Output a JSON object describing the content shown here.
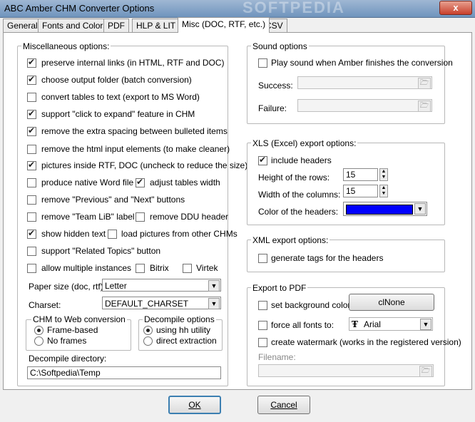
{
  "window": {
    "title": "ABC Amber CHM Converter Options",
    "watermark": "SOFTPEDIA",
    "close_glyph": "x"
  },
  "tabs": [
    {
      "label": "General"
    },
    {
      "label": "Fonts and Colors"
    },
    {
      "label": "PDF"
    },
    {
      "label": "HLP & LIT"
    },
    {
      "label": "Misc (DOC, RTF, etc.)",
      "active": true
    },
    {
      "label": "CSV"
    }
  ],
  "misc": {
    "title": "Miscellaneous options:",
    "options": [
      {
        "label": "preserve internal links (in HTML, RTF and DOC)",
        "checked": true
      },
      {
        "label": "choose output folder (batch conversion)",
        "checked": true
      },
      {
        "label": "convert tables to text (export to MS Word)",
        "checked": false
      },
      {
        "label": "support \"click to expand\" feature in CHM",
        "checked": true
      },
      {
        "label": "remove the extra spacing between bulleted items",
        "checked": true
      },
      {
        "label": "remove the html input elements (to make cleaner)",
        "checked": false
      },
      {
        "label": "pictures inside RTF, DOC (uncheck to reduce the size)",
        "checked": true
      },
      {
        "label": "produce native Word file",
        "checked": false
      },
      {
        "label": "adjust tables width",
        "checked": true
      },
      {
        "label": "remove \"Previous\" and \"Next\" buttons",
        "checked": false
      },
      {
        "label": "remove \"Team LiB\" label",
        "checked": false
      },
      {
        "label": "remove DDU header",
        "checked": false
      },
      {
        "label": "show hidden text",
        "checked": true
      },
      {
        "label": "load pictures from other CHMs",
        "checked": false
      },
      {
        "label": "support \"Related Topics\" button",
        "checked": false
      },
      {
        "label": "allow multiple instances",
        "checked": false
      },
      {
        "label": "Bitrix",
        "checked": false
      },
      {
        "label": "Virtek",
        "checked": false
      }
    ],
    "paper_size_label": "Paper size (doc, rtf):",
    "paper_size_value": "Letter",
    "charset_label": "Charset:",
    "charset_value": "DEFAULT_CHARSET",
    "chm_web": {
      "title": "CHM to Web conversion",
      "options": [
        {
          "label": "Frame-based",
          "selected": true
        },
        {
          "label": "No frames",
          "selected": false
        }
      ]
    },
    "decompile": {
      "title": "Decompile options",
      "options": [
        {
          "label": "using hh utility",
          "selected": true
        },
        {
          "label": "direct extraction",
          "selected": false
        }
      ]
    },
    "decompile_dir_label": "Decompile directory:",
    "decompile_dir_value": "C:\\Softpedia\\Temp"
  },
  "sound": {
    "title": "Sound options",
    "play_label": "Play sound when Amber finishes the conversion",
    "play_checked": false,
    "success_label": "Success:",
    "success_value": "",
    "failure_label": "Failure:",
    "failure_value": ""
  },
  "xls": {
    "title": "XLS (Excel) export options:",
    "include_headers_label": "include headers",
    "include_headers_checked": true,
    "row_height_label": "Height of the rows:",
    "row_height_value": "15",
    "col_width_label": "Width of the columns:",
    "col_width_value": "15",
    "header_color_label": "Color of the headers:",
    "header_color": "#0000ff"
  },
  "xml": {
    "title": "XML export options:",
    "gen_tags_label": "generate tags for the headers",
    "gen_tags_checked": false
  },
  "pdf": {
    "title": "Export to PDF",
    "bg_color_label": "set background color",
    "bg_color_checked": false,
    "bg_color_button": "clNone",
    "force_fonts_label": "force all fonts to:",
    "force_fonts_checked": false,
    "font_value": "Arial",
    "watermark_label": "create watermark (works in the registered version)",
    "watermark_checked": false,
    "filename_label": "Filename:",
    "filename_value": ""
  },
  "buttons": {
    "ok": "OK",
    "cancel": "Cancel"
  }
}
